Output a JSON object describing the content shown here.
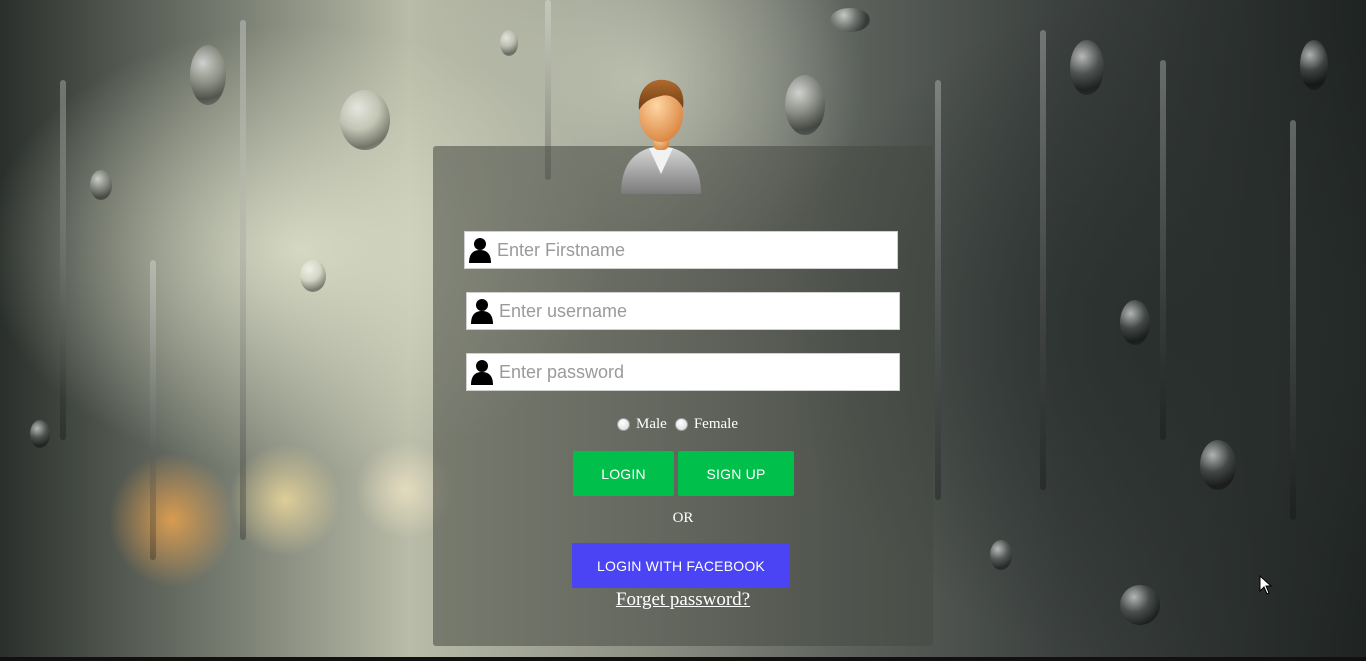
{
  "form": {
    "fields": [
      {
        "name": "firstname",
        "placeholder": "Enter Firstname",
        "type": "text",
        "icon": "user-icon"
      },
      {
        "name": "username",
        "placeholder": "Enter username",
        "type": "text",
        "icon": "user-icon"
      },
      {
        "name": "password",
        "placeholder": "Enter password",
        "type": "password",
        "icon": "user-icon"
      }
    ],
    "gender": {
      "options": [
        "Male",
        "Female"
      ]
    },
    "login_label": "LOGIN",
    "signup_label": "SIGN UP",
    "or_label": "OR",
    "facebook_label": "LOGIN WITH FACEBOOK",
    "forgot_label": "Forget password?"
  },
  "colors": {
    "green_button": "#00c04b",
    "facebook_button": "#4b44f5",
    "panel": "rgba(70,72,66,0.55)"
  },
  "icons": {
    "avatar": "user-avatar-icon",
    "field_icon": "user-icon",
    "cursor": "mouse-cursor-icon"
  }
}
